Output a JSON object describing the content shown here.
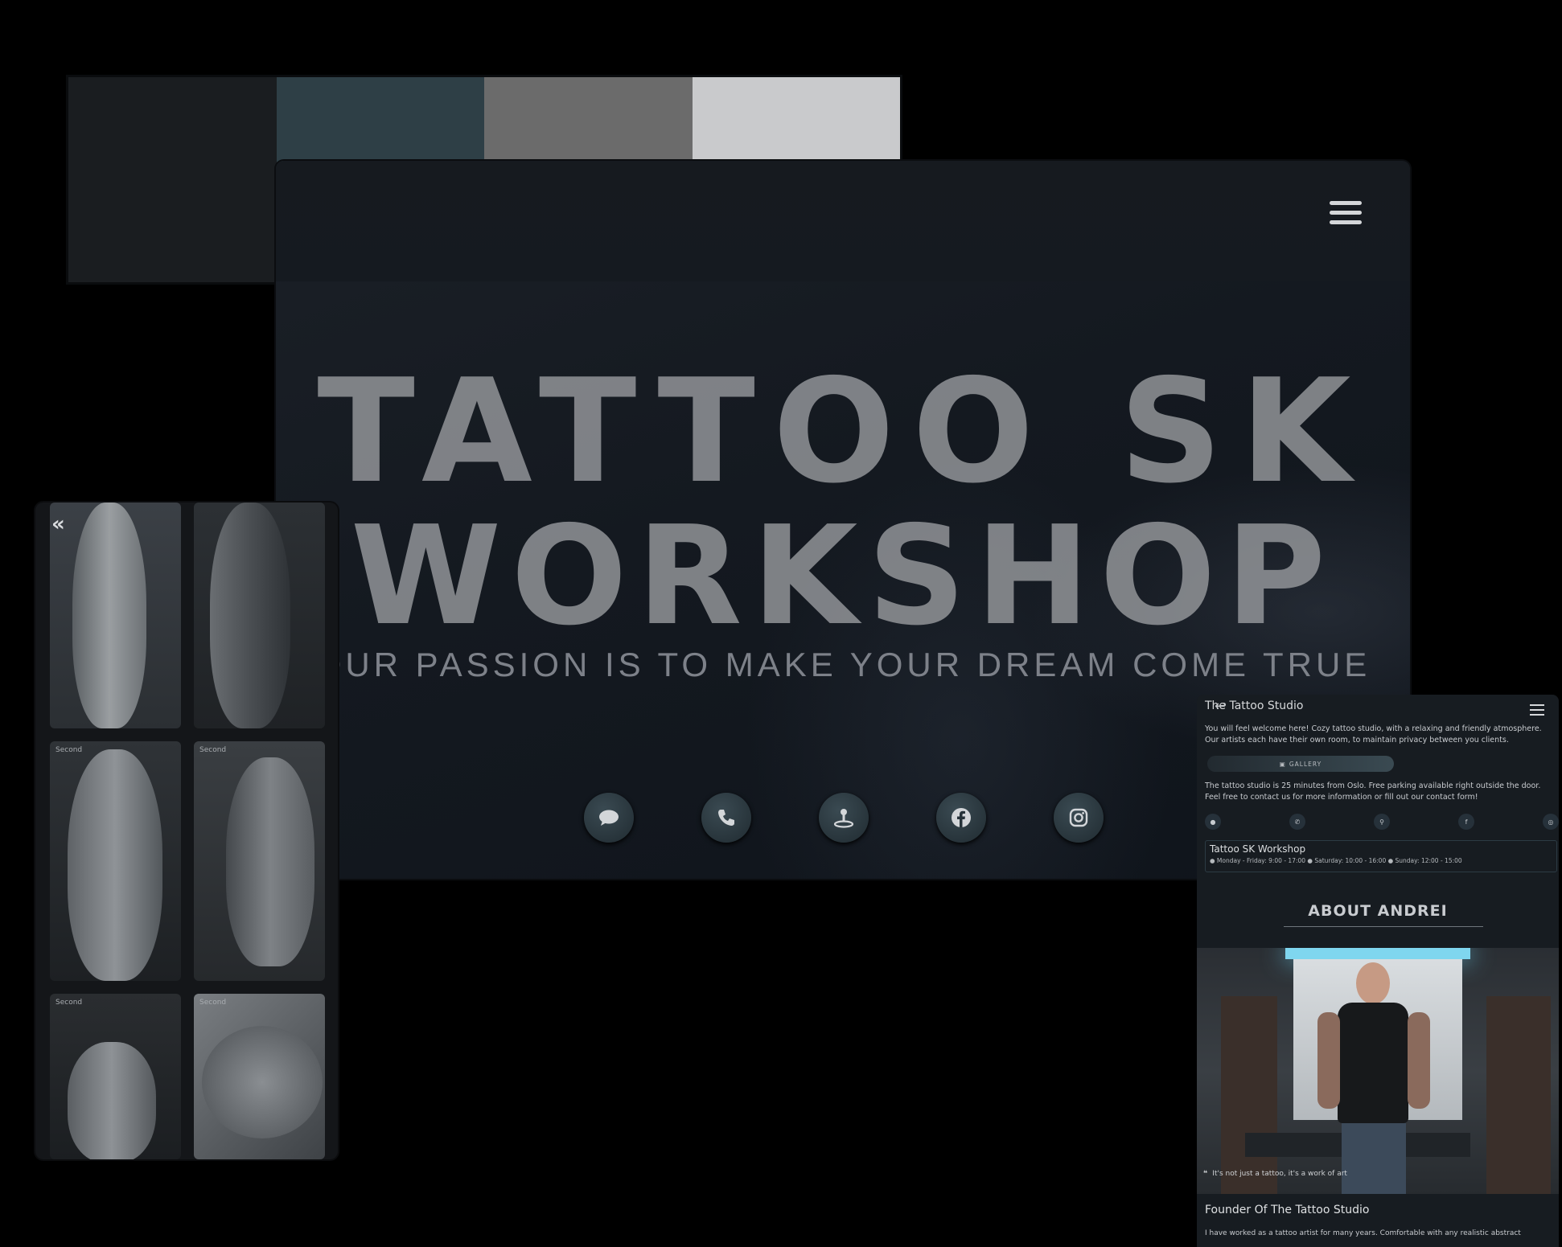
{
  "palette": {
    "colors": [
      "#1a1d20",
      "#2e3f46",
      "#6b6b6b",
      "#c9cacc"
    ]
  },
  "hero": {
    "title_line1": "TATTOO SK",
    "title_line2": "WORKSHOP",
    "subtitle": "OUR PASSION IS TO MAKE YOUR DREAM COME TRUE",
    "icons": [
      "chat-icon",
      "phone-icon",
      "map-pin-icon",
      "facebook-icon",
      "instagram-icon"
    ]
  },
  "gallery": {
    "back": "«",
    "labels": [
      "Second",
      "Second",
      "Second",
      "Second"
    ]
  },
  "mobile": {
    "header_title": "The Tattoo Studio",
    "intro": "You will feel welcome here! Cozy tattoo studio, with a relaxing and friendly atmosphere. Our artists each have their own room, to maintain privacy between you clients.",
    "gallery_button": "GALLERY",
    "location": "The tattoo studio is 25 minutes from Oslo. Free parking available right outside the door. Feel free to contact us for more information or fill out our contact form!",
    "hours_title": "Tattoo SK Workshop",
    "hours_text": "● Monday - Friday: 9:00 - 17:00 ● Saturday: 10:00 - 16:00 ● Sunday: 12:00 - 15:00",
    "about_heading": "ABOUT ANDREI",
    "quote": "It's not just a tattoo, it's a work of art",
    "founder_title": "Founder Of The Tattoo Studio",
    "founder_text": "I have worked as a tattoo artist for many years. Comfortable with any realistic abstract"
  }
}
